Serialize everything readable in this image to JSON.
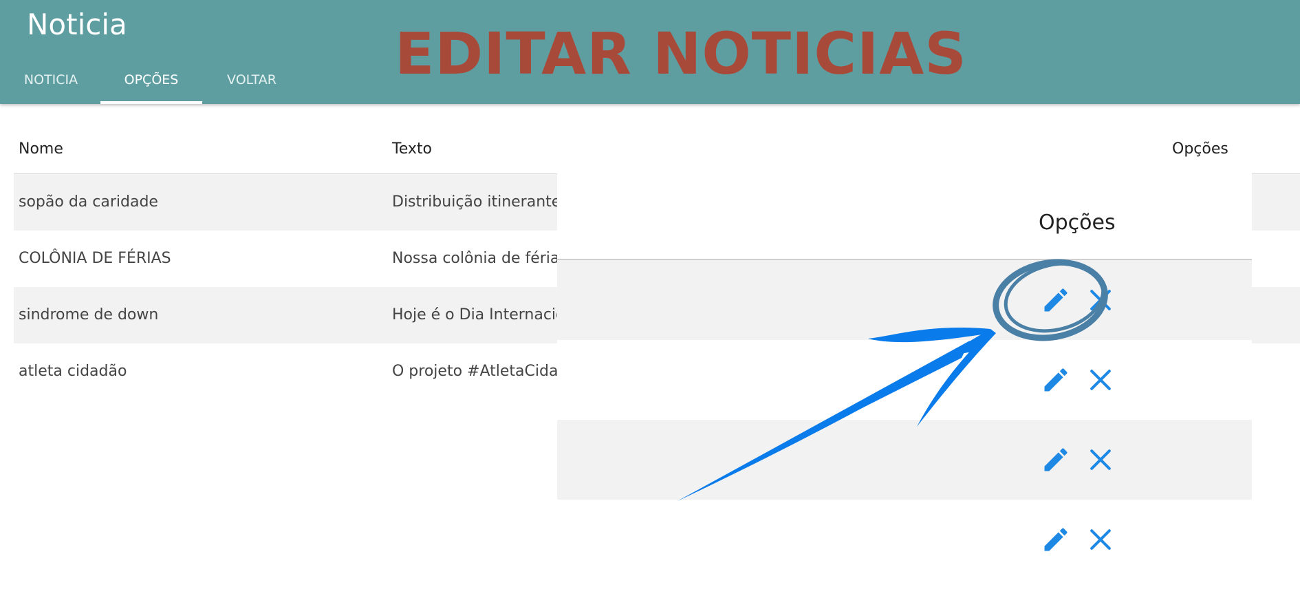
{
  "header": {
    "brand": "Noticia",
    "overlay_title": "EDITAR NOTICIAS",
    "tabs": [
      {
        "label": "NOTICIA",
        "active": false
      },
      {
        "label": "OPÇÕES",
        "active": true
      },
      {
        "label": "VOLTAR",
        "active": false
      }
    ]
  },
  "table": {
    "columns": [
      "Nome",
      "Texto",
      "Opções"
    ],
    "rows": [
      {
        "nome": "sopão da caridade",
        "texto": "Distribuição itinerante c"
      },
      {
        "nome": "COLÔNIA DE FÉRIAS",
        "texto": "Nossa colônia de férias"
      },
      {
        "nome": "sindrome de down",
        "texto": "Hoje é o Dia Internacior"
      },
      {
        "nome": "atleta cidadão",
        "texto": "O projeto #AtletaCidad"
      }
    ]
  },
  "inset": {
    "header": "Opções",
    "actions": [
      {
        "edit_icon": "pencil-icon",
        "delete_icon": "close-icon"
      },
      {
        "edit_icon": "pencil-icon",
        "delete_icon": "close-icon"
      },
      {
        "edit_icon": "pencil-icon",
        "delete_icon": "close-icon"
      },
      {
        "edit_icon": "pencil-icon",
        "delete_icon": "close-icon"
      }
    ]
  },
  "colors": {
    "header_bg": "#5f9ea0",
    "overlay_title": "#a84a3a",
    "action_icon": "#1e88e5",
    "annotation_arrow": "#0a7bea",
    "annotation_circle": "#4a7fa6"
  }
}
